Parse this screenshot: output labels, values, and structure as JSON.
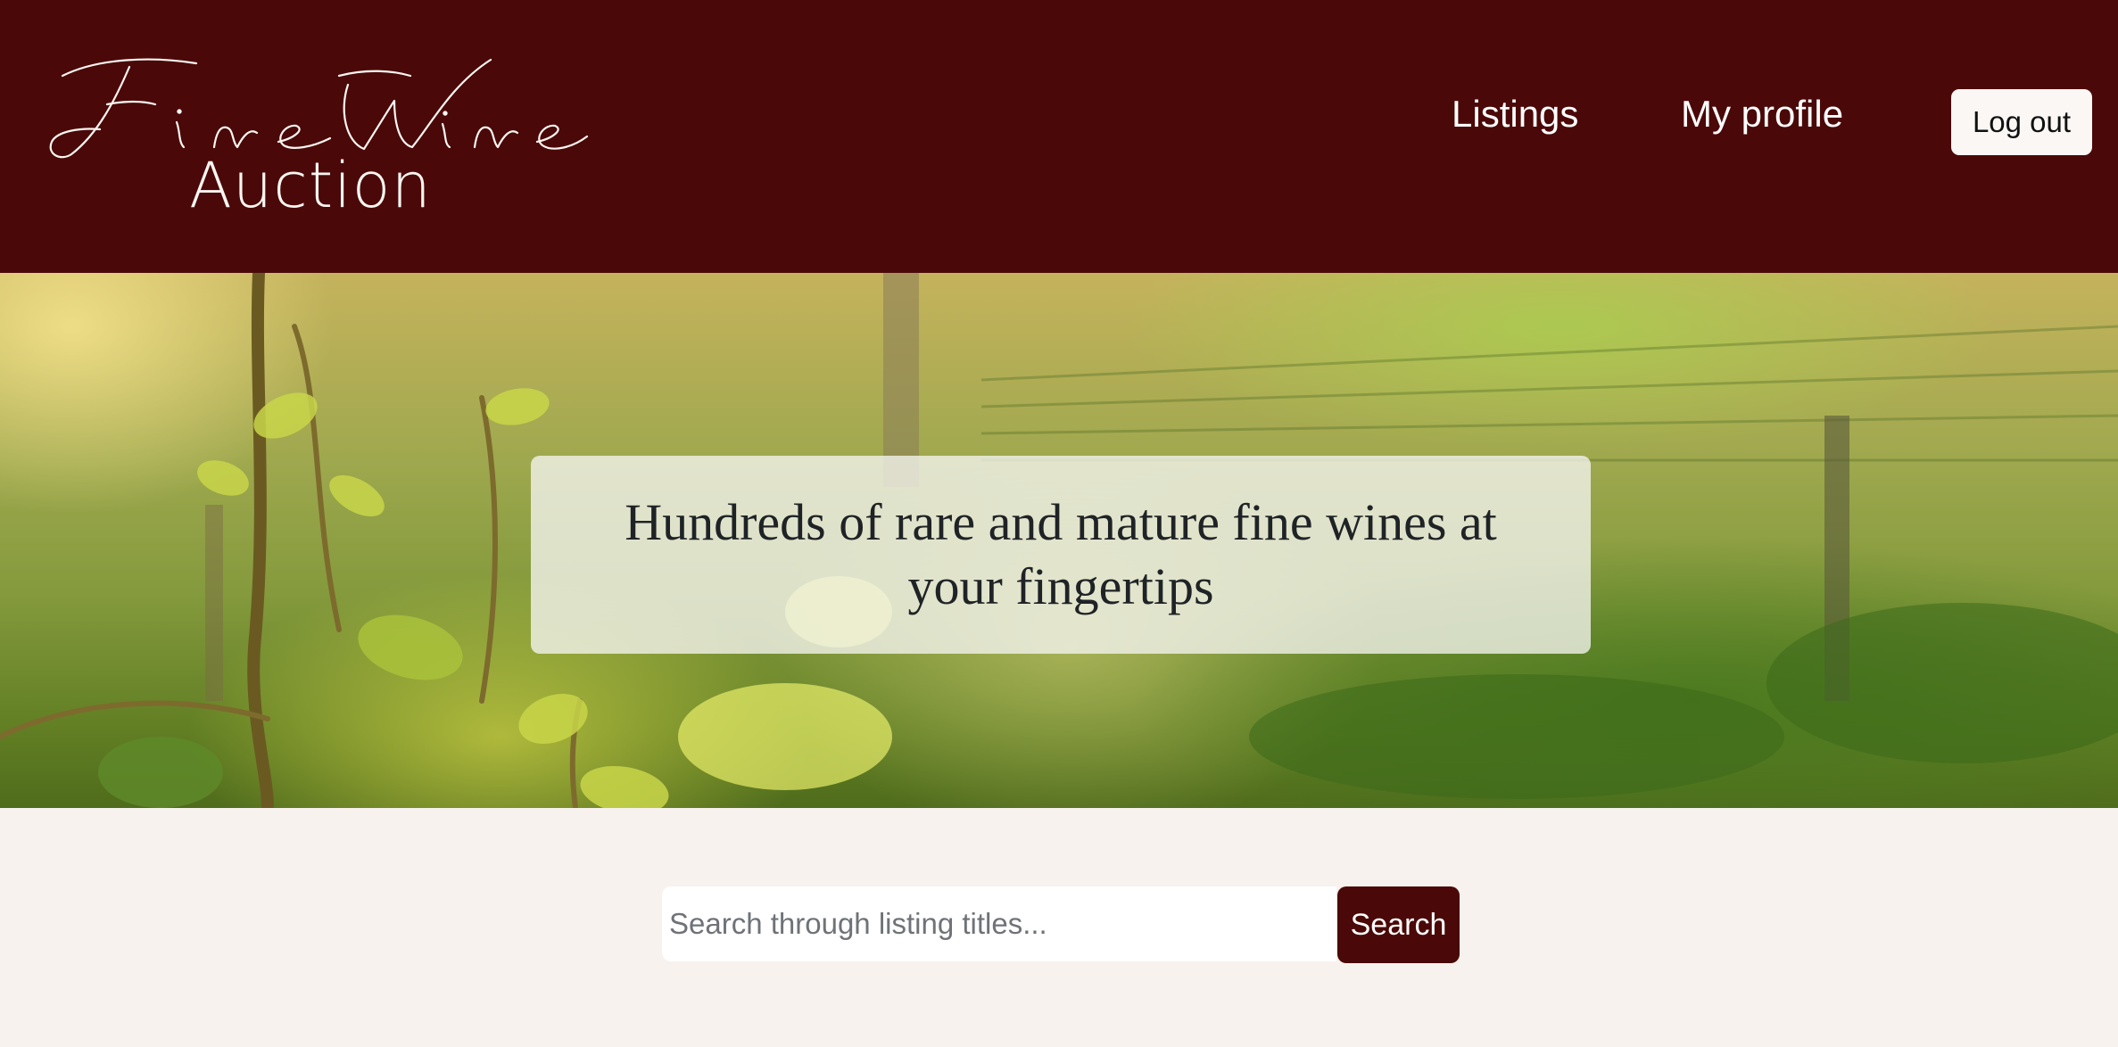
{
  "brand": {
    "script_text": "Fine Wine",
    "subtitle": "Auction"
  },
  "nav": {
    "listings": "Listings",
    "my_profile": "My profile",
    "logout": "Log out"
  },
  "hero": {
    "title": "Hundreds of rare and mature fine wines at your fingertips"
  },
  "search": {
    "placeholder": "Search through listing titles...",
    "value": "",
    "button_label": "Search"
  },
  "colors": {
    "brand_primary": "#4a0908",
    "page_background": "#f7f2ee"
  }
}
